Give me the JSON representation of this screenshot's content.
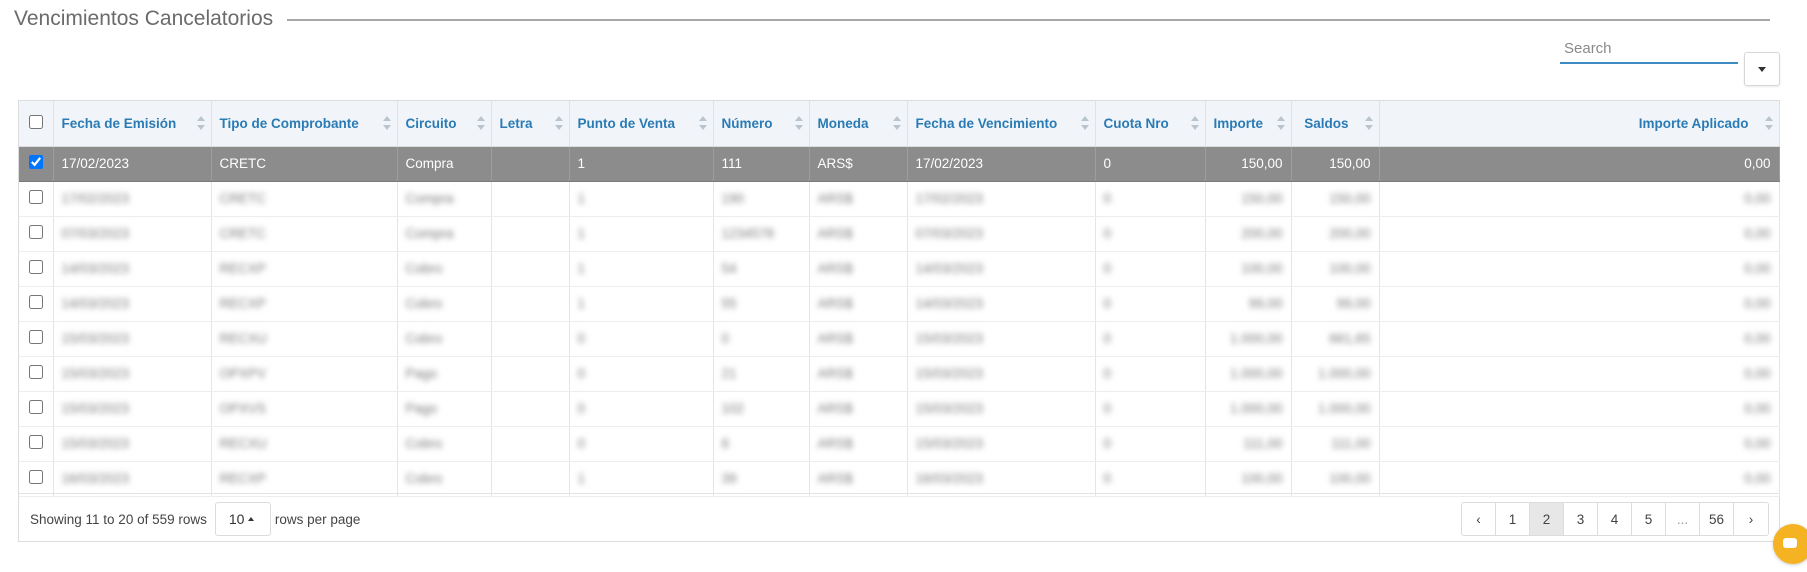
{
  "section": {
    "title": "Vencimientos Cancelatorios"
  },
  "search": {
    "placeholder": "Search",
    "value": ""
  },
  "columns": [
    {
      "key": "fecha_emision",
      "label": "Fecha de Emisión",
      "align": "left"
    },
    {
      "key": "tipo",
      "label": "Tipo de Comprobante",
      "align": "left"
    },
    {
      "key": "circuito",
      "label": "Circuito",
      "align": "left"
    },
    {
      "key": "letra",
      "label": "Letra",
      "align": "left"
    },
    {
      "key": "punto_venta",
      "label": "Punto de Venta",
      "align": "left"
    },
    {
      "key": "numero",
      "label": "Número",
      "align": "left"
    },
    {
      "key": "moneda",
      "label": "Moneda",
      "align": "left"
    },
    {
      "key": "fecha_venc",
      "label": "Fecha de Vencimiento",
      "align": "left"
    },
    {
      "key": "cuota",
      "label": "Cuota Nro",
      "align": "left"
    },
    {
      "key": "importe",
      "label": "Importe",
      "align": "right"
    },
    {
      "key": "saldos",
      "label": "Saldos",
      "align": "right"
    },
    {
      "key": "importe_aplicado",
      "label": "Importe Aplicado",
      "align": "right"
    }
  ],
  "rows": [
    {
      "checked": true,
      "blurred": false,
      "cells": [
        "17/02/2023",
        "CRETC",
        "Compra",
        "",
        "1",
        "111",
        "ARS$",
        "17/02/2023",
        "0",
        "150,00",
        "150,00",
        "0,00"
      ]
    },
    {
      "checked": false,
      "blurred": true,
      "cells": [
        "17/02/2023",
        "CRETC",
        "Compra",
        "",
        "1",
        "190",
        "ARS$",
        "17/02/2023",
        "0",
        "150,00",
        "150,00",
        "0,00"
      ]
    },
    {
      "checked": false,
      "blurred": true,
      "cells": [
        "07/03/2023",
        "CRETC",
        "Compra",
        "",
        "1",
        "1234578",
        "ARS$",
        "07/03/2023",
        "0",
        "200,00",
        "200,00",
        "0,00"
      ]
    },
    {
      "checked": false,
      "blurred": true,
      "cells": [
        "14/03/2023",
        "RECXP",
        "Cobro",
        "",
        "1",
        "54",
        "ARS$",
        "14/03/2023",
        "0",
        "100,00",
        "100,00",
        "0,00"
      ]
    },
    {
      "checked": false,
      "blurred": true,
      "cells": [
        "14/03/2023",
        "RECXP",
        "Cobro",
        "",
        "1",
        "55",
        "ARS$",
        "14/03/2023",
        "0",
        "99,00",
        "99,00",
        "0,00"
      ]
    },
    {
      "checked": false,
      "blurred": true,
      "cells": [
        "15/03/2023",
        "RECXU",
        "Cobro",
        "",
        "0",
        "0",
        "ARS$",
        "15/03/2023",
        "0",
        "1.000,00",
        "661,65",
        "0,00"
      ]
    },
    {
      "checked": false,
      "blurred": true,
      "cells": [
        "15/03/2023",
        "OPXPV",
        "Pago",
        "",
        "0",
        "21",
        "ARS$",
        "15/03/2023",
        "0",
        "1.000,00",
        "1.000,00",
        "0,00"
      ]
    },
    {
      "checked": false,
      "blurred": true,
      "cells": [
        "15/03/2023",
        "OPXVS",
        "Pago",
        "",
        "0",
        "102",
        "ARS$",
        "15/03/2023",
        "0",
        "1.000,00",
        "1.000,00",
        "0,00"
      ]
    },
    {
      "checked": false,
      "blurred": true,
      "cells": [
        "15/03/2023",
        "RECXU",
        "Cobro",
        "",
        "0",
        "6",
        "ARS$",
        "15/03/2023",
        "0",
        "111,00",
        "111,00",
        "0,00"
      ]
    },
    {
      "checked": false,
      "blurred": true,
      "cells": [
        "16/03/2023",
        "RECXP",
        "Cobro",
        "",
        "1",
        "39",
        "ARS$",
        "16/03/2023",
        "0",
        "100,00",
        "100,00",
        "0,00"
      ]
    }
  ],
  "pagination": {
    "info": "Showing 11 to 20 of 559 rows",
    "page_size": "10",
    "rows_per_page_label": "rows per page",
    "prev": "‹",
    "next": "›",
    "pages": [
      "1",
      "2",
      "3",
      "4",
      "5",
      "...",
      "56"
    ],
    "active": "2"
  },
  "colors": {
    "accent": "#2a7bb5",
    "selected_row": "#8c8c8c",
    "chat": "#f5b324"
  }
}
